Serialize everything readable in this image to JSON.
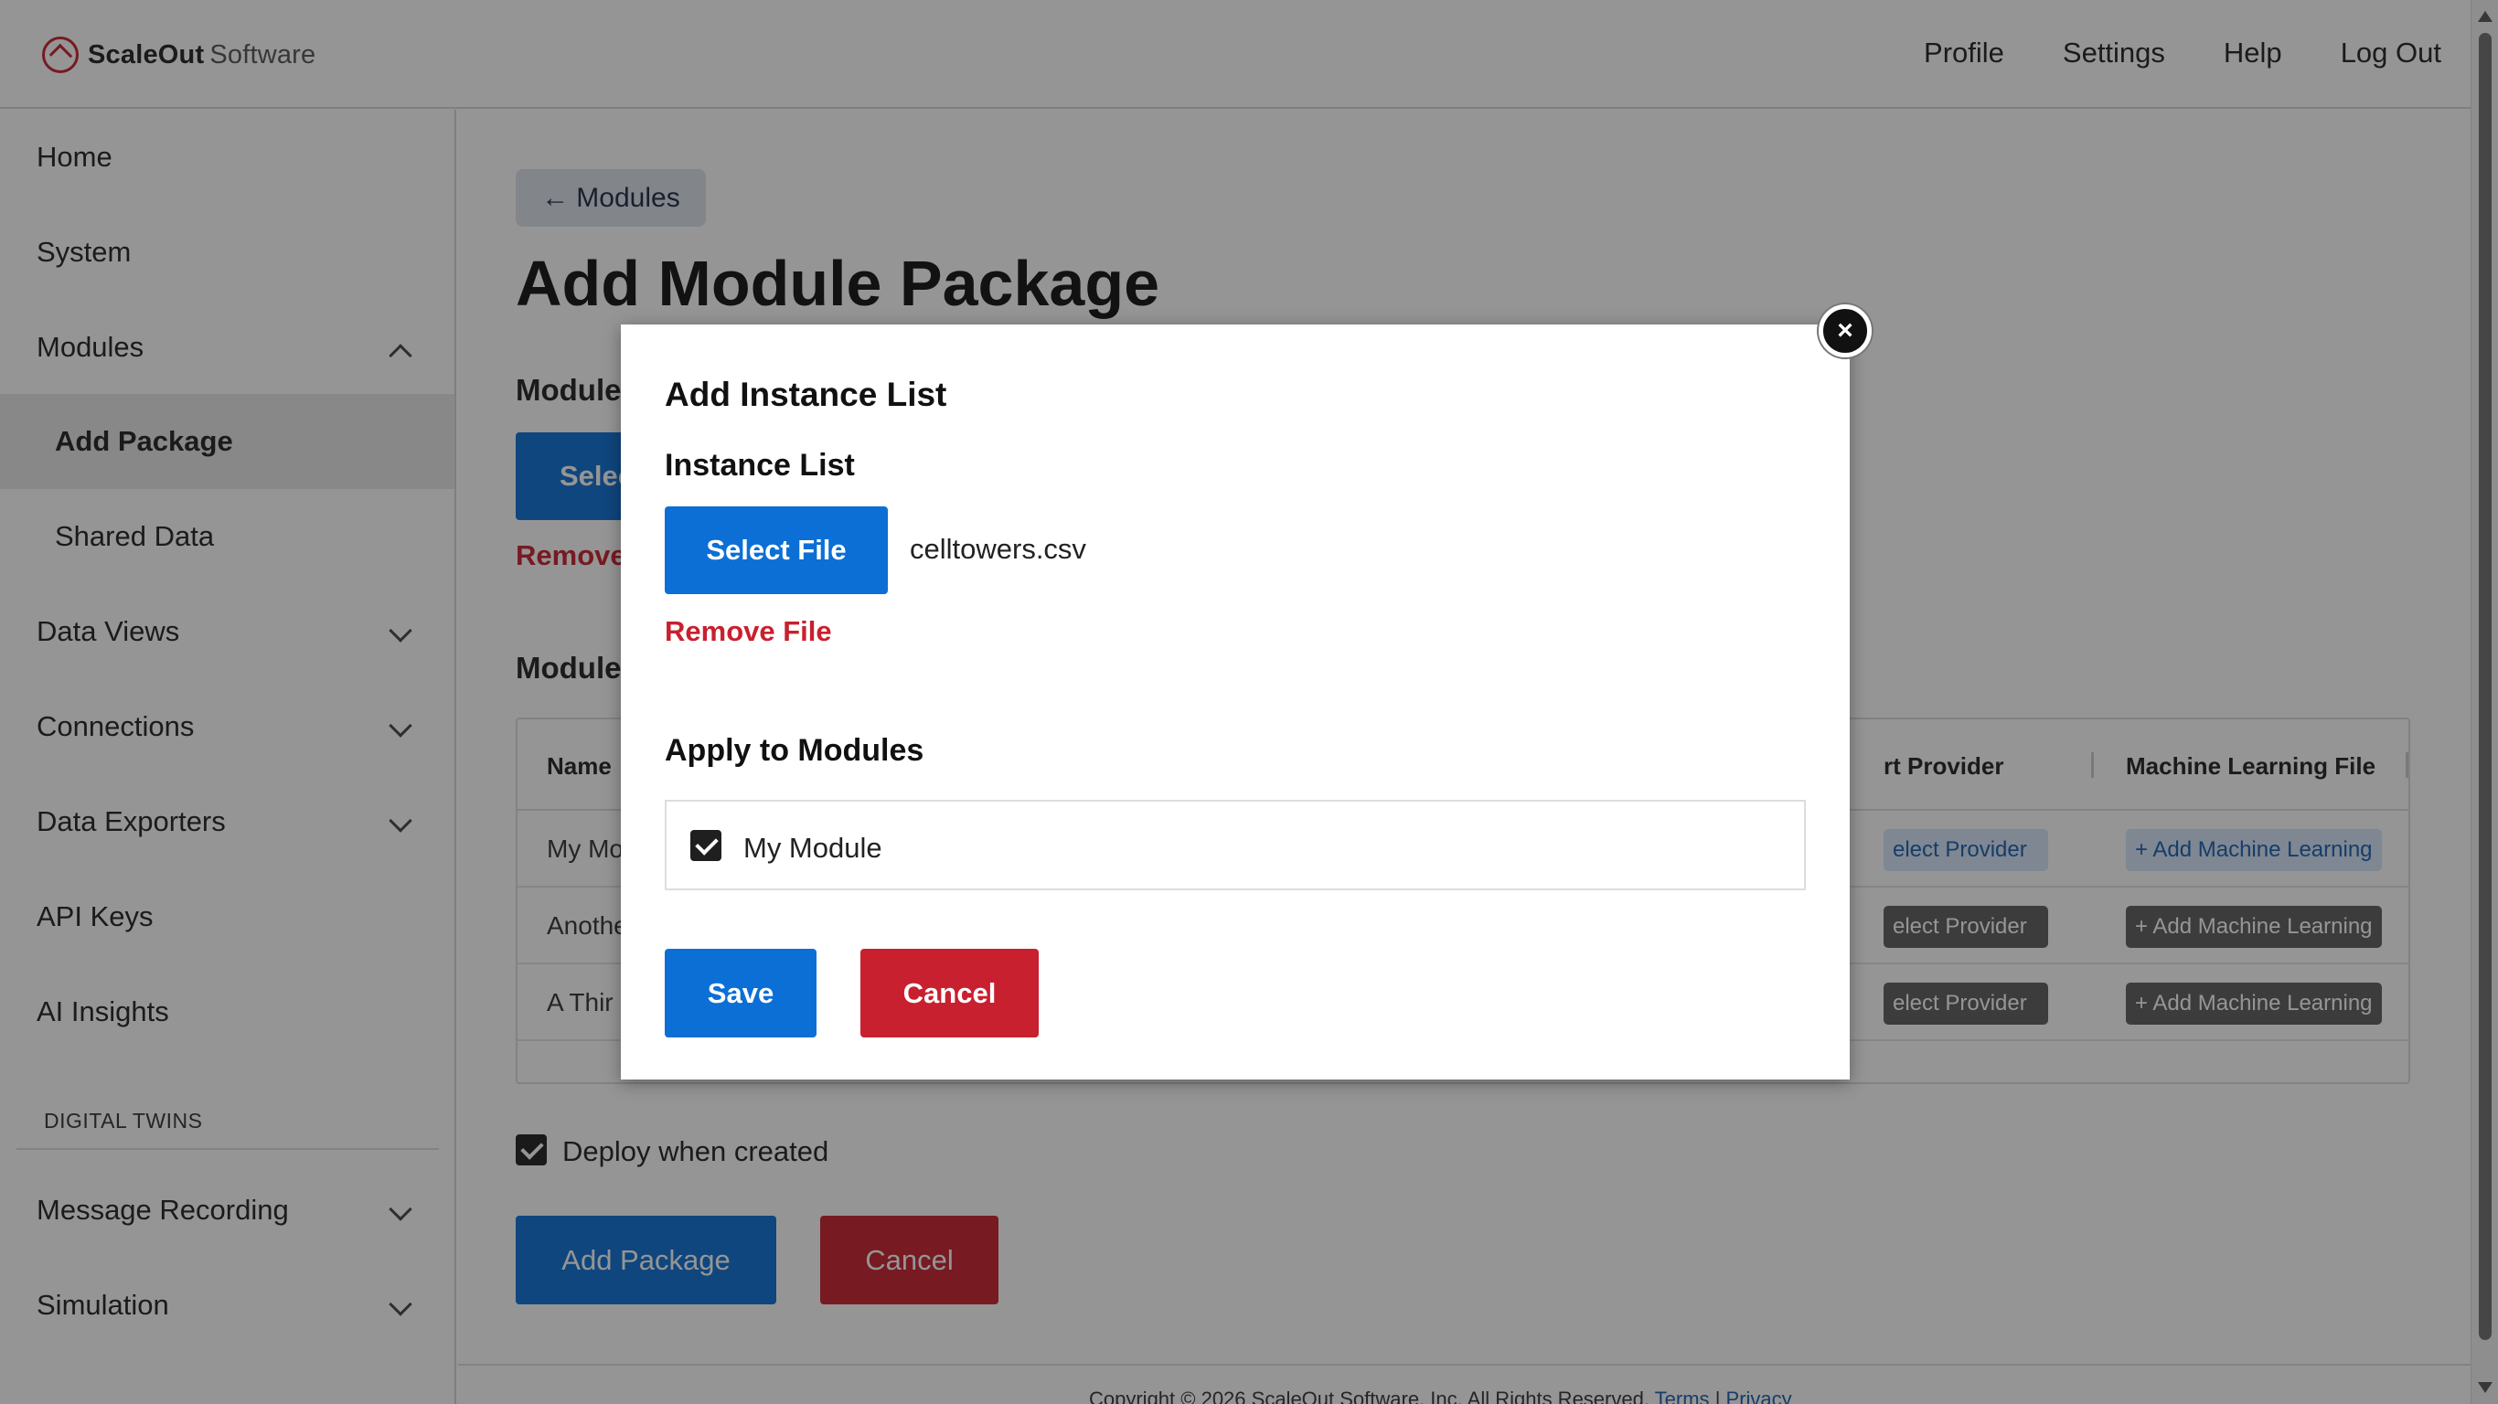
{
  "brand": {
    "name_bold": "ScaleOut",
    "name_light": "Software"
  },
  "topnav": [
    "Profile",
    "Settings",
    "Help",
    "Log Out"
  ],
  "sidebar": {
    "items": [
      {
        "label": "Home"
      },
      {
        "label": "System"
      },
      {
        "label": "Modules"
      },
      {
        "label": "Add Package"
      },
      {
        "label": "Shared Data"
      },
      {
        "label": "Data Views"
      },
      {
        "label": "Connections"
      },
      {
        "label": "Data Exporters"
      },
      {
        "label": "API Keys"
      },
      {
        "label": "AI Insights"
      },
      {
        "label": "Message Recording"
      },
      {
        "label": "Simulation"
      }
    ],
    "section_label": "DIGITAL TWINS"
  },
  "main": {
    "back_label": "Modules",
    "title": "Add Module Package",
    "section1_head": "Module",
    "select_label": "Selec",
    "remove_label": "Remove",
    "section2_head": "Module",
    "table": {
      "headers": {
        "name": "Name",
        "provider": "rt Provider",
        "ml": "Machine Learning File"
      },
      "rows": [
        {
          "name": "My Mo",
          "provider": "elect Provider",
          "ml": "+ Add Machine Learning"
        },
        {
          "name": "Anothe",
          "provider": "elect Provider",
          "ml": "+ Add Machine Learning"
        },
        {
          "name": "A Thir",
          "provider": "elect Provider",
          "ml": "+ Add Machine Learning"
        }
      ]
    },
    "deploy_label": "Deploy when created",
    "add_package_label": "Add Package",
    "cancel_label": "Cancel",
    "footer": {
      "text": "Copyright © 2026 ScaleOut Software, Inc. All Rights Reserved.",
      "terms": "Terms",
      "sep": "|",
      "privacy": "Privacy"
    }
  },
  "modal": {
    "close_glyph": "×",
    "title": "Add Instance List",
    "instance_label": "Instance List",
    "select_file_label": "Select File",
    "file_name": "celltowers.csv",
    "remove_file_label": "Remove File",
    "apply_label": "Apply to Modules",
    "module_option": "My Module",
    "module_checked": true,
    "save_label": "Save",
    "cancel_label": "Cancel"
  },
  "colors": {
    "primary": "#0b6fd6",
    "danger": "#c8202f",
    "brand_red": "#c8202f",
    "dark_button": "#5e5e5e"
  }
}
